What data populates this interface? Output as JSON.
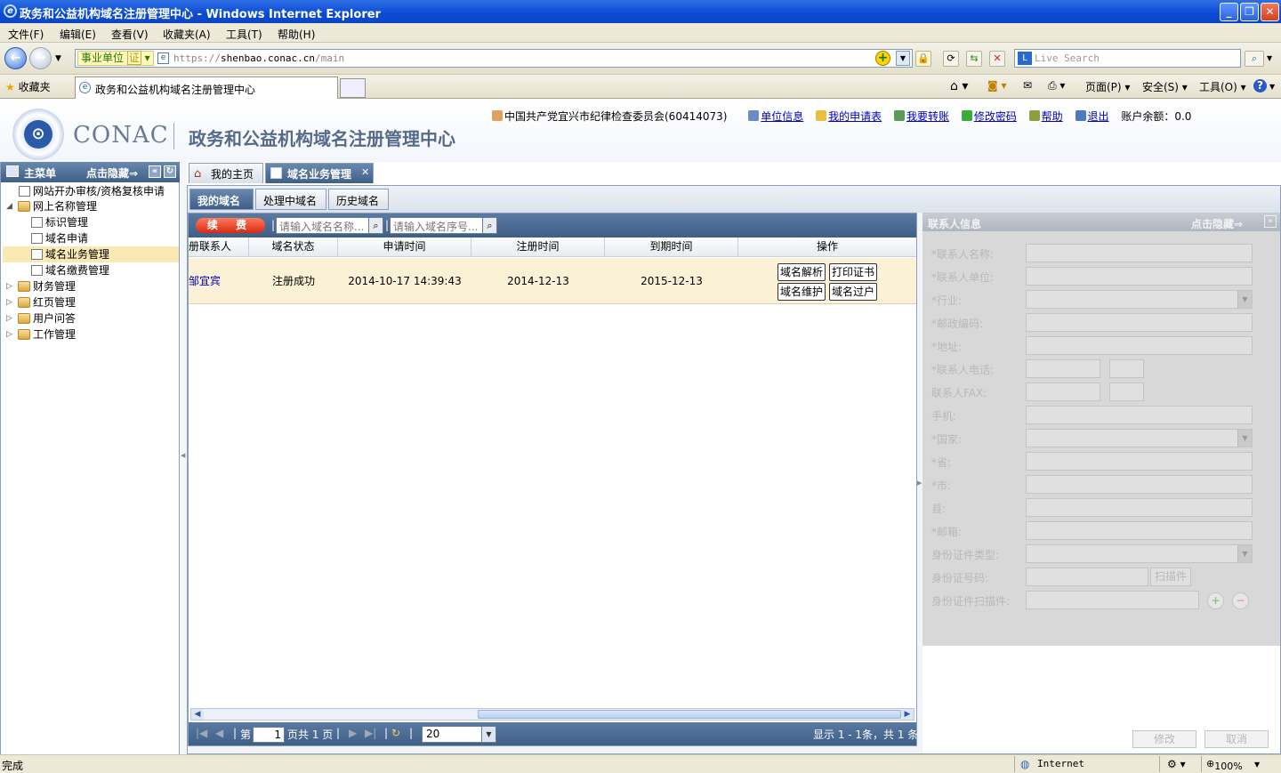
{
  "window": {
    "title": "政务和公益机构域名注册管理中心 - Windows Internet Explorer",
    "min_label": "_",
    "max_label": "❐",
    "close_label": "✕"
  },
  "menu": [
    "文件(F)",
    "编辑(E)",
    "查看(V)",
    "收藏夹(A)",
    "工具(T)",
    "帮助(H)"
  ],
  "address": {
    "badge": "事业单位",
    "cert": "证",
    "scheme": "https://",
    "host": "shenbao.conac.cn",
    "path": "/main"
  },
  "search": {
    "placeholder": "Live Search"
  },
  "favbar": {
    "favorites": "收藏夹",
    "tab_title": "政务和公益机构域名注册管理中心",
    "page_menu": "页面(P)",
    "safety_menu": "安全(S)",
    "tools_menu": "工具(O)"
  },
  "header": {
    "logo_text": "CONAC",
    "system_name": "政务和公益机构域名注册管理中心",
    "user": "中国共产党宜兴市纪律检查委员会(60414073)",
    "links": [
      "单位信息",
      "我的申请表",
      "我要转账",
      "修改密码",
      "帮助",
      "退出"
    ],
    "balance": "账户余额：0.0"
  },
  "sidebar": {
    "title": "主菜单",
    "hide": "点击隐藏⇒",
    "items": [
      {
        "label": "网站开办审核/资格复核申请",
        "level": 0,
        "type": "page"
      },
      {
        "label": "网上名称管理",
        "level": 0,
        "type": "folder-open"
      },
      {
        "label": "标识管理",
        "level": 1,
        "type": "page"
      },
      {
        "label": "域名申请",
        "level": 1,
        "type": "page"
      },
      {
        "label": "域名业务管理",
        "level": 1,
        "type": "page",
        "selected": true
      },
      {
        "label": "域名缴费管理",
        "level": 1,
        "type": "page"
      },
      {
        "label": "财务管理",
        "level": 0,
        "type": "folder"
      },
      {
        "label": "红页管理",
        "level": 0,
        "type": "folder"
      },
      {
        "label": "用户问答",
        "level": 0,
        "type": "folder"
      },
      {
        "label": "工作管理",
        "level": 0,
        "type": "folder"
      }
    ]
  },
  "tabs": {
    "home": "我的主页",
    "active": "域名业务管理",
    "close": "✕"
  },
  "subtabs": [
    "我的域名",
    "处理中域名",
    "历史域名"
  ],
  "grid": {
    "renew": "续 费",
    "search_name": "请输入域名名称...",
    "search_seq": "请输入域名序号...",
    "columns": [
      "册联系人",
      "域名状态",
      "申请时间",
      "注册时间",
      "到期时间",
      "操作"
    ],
    "rows": [
      {
        "contact": "邹宜宾",
        "status": "注册成功",
        "applied": "2014-10-17 14:39:43",
        "registered": "2014-12-13",
        "expires": "2015-12-13",
        "actions": [
          "域名解析",
          "打印证书",
          "域名维护",
          "域名过户"
        ]
      }
    ],
    "pager": {
      "page_prefix": "第",
      "page": "1",
      "page_suffix": "页共 1 页",
      "page_size": "20",
      "summary": "显示 1 - 1条，共 1 条"
    }
  },
  "contact": {
    "title": "联系人信息",
    "hide": "点击隐藏⇒",
    "fields": [
      "*联系人名称:",
      "*联系人单位:",
      "*行业:",
      "*邮政编码:",
      "*地址:",
      "*联系人电话:",
      "联系人FAX:",
      "手机:",
      "*国家:",
      "*省:",
      "*市:",
      "县:",
      "*邮箱:",
      "身份证件类型:",
      "身份证号码:",
      "身份证件扫描件:"
    ],
    "scan_button": "扫描件",
    "edit_button": "修改",
    "cancel_button": "取消"
  },
  "status": {
    "left": "完成",
    "zone": "Internet",
    "zoom": "100%"
  }
}
